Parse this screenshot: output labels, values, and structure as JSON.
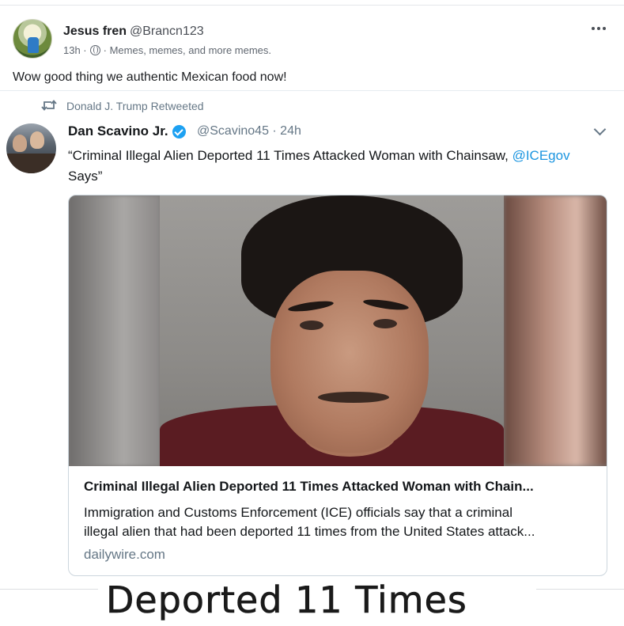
{
  "post": {
    "author_name": "Jesus fren",
    "author_handle": "@Brancn123",
    "time": "13h ·",
    "audience_icon": "globe-icon",
    "group": "· Memes, memes, and more memes.",
    "text": "Wow good thing we authentic Mexican food now!",
    "more_icon": "more-options-icon"
  },
  "tweet": {
    "retweet_label": "Donald J. Trump Retweeted",
    "retweet_icon": "retweet-icon",
    "author_name": "Dan Scavino Jr.",
    "verified_icon": "verified-badge-icon",
    "author_handle": "@Scavino45 · 24h",
    "text_before_link": "“Criminal Illegal Alien Deported 11 Times Attacked Woman with Chainsaw, ",
    "link_text": "@ICEgov",
    "text_after_link": " Says”",
    "link_color": "#1b95e0",
    "verified_color": "#1da1f2",
    "card": {
      "title": "Criminal Illegal Alien Deported 11 Times Attacked Woman with Chain...",
      "description_line1": "Immigration and Customs Enforcement (ICE) officials say that a criminal",
      "description_line2": "illegal alien that had been deported 11 times from the United States attack...",
      "domain": "dailywire.com"
    }
  },
  "caption": {
    "text": "Deported 11 Times"
  }
}
